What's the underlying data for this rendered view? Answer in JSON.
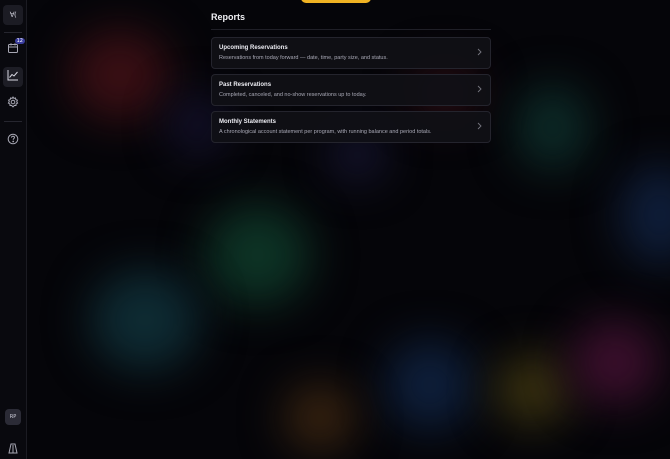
{
  "sidebar": {
    "logo_text": "∀(",
    "reservations_badge": "12",
    "avatar_initials": "RP",
    "items": [
      {
        "name": "reservations",
        "icon": "calendar-icon"
      },
      {
        "name": "reports",
        "icon": "chart-line-icon",
        "active": true
      },
      {
        "name": "settings",
        "icon": "gear-icon"
      },
      {
        "name": "help",
        "icon": "question-icon"
      }
    ]
  },
  "page": {
    "title": "Reports"
  },
  "reports": [
    {
      "title": "Upcoming Reservations",
      "description": "Reservations from today forward — date, time, party size, and status."
    },
    {
      "title": "Past Reservations",
      "description": "Completed, canceled, and no-show reservations up to today."
    },
    {
      "title": "Monthly Statements",
      "description": "A chronological account statement per program, with running balance and period totals."
    }
  ],
  "colors": {
    "background": "#050509",
    "accent_pill": "#f0b323",
    "badge": "#3a3d9e"
  }
}
